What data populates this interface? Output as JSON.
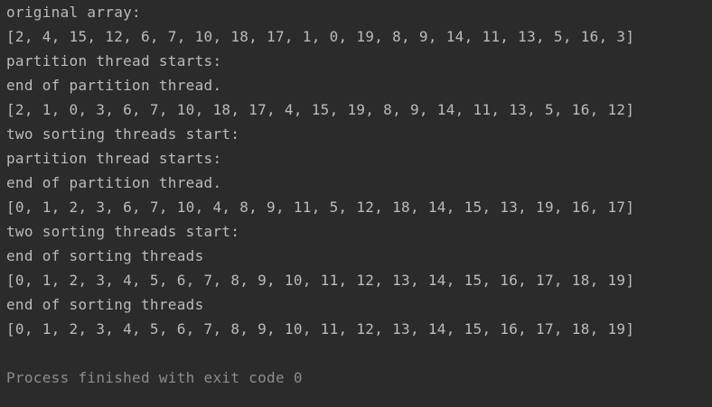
{
  "console": {
    "lines": [
      "original array:",
      "[2, 4, 15, 12, 6, 7, 10, 18, 17, 1, 0, 19, 8, 9, 14, 11, 13, 5, 16, 3]",
      "partition thread starts:",
      "end of partition thread.",
      "[2, 1, 0, 3, 6, 7, 10, 18, 17, 4, 15, 19, 8, 9, 14, 11, 13, 5, 16, 12]",
      "two sorting threads start:",
      "partition thread starts:",
      "end of partition thread.",
      "[0, 1, 2, 3, 6, 7, 10, 4, 8, 9, 11, 5, 12, 18, 14, 15, 13, 19, 16, 17]",
      "two sorting threads start:",
      "end of sorting threads",
      "[0, 1, 2, 3, 4, 5, 6, 7, 8, 9, 10, 11, 12, 13, 14, 15, 16, 17, 18, 19]",
      "end of sorting threads",
      "[0, 1, 2, 3, 4, 5, 6, 7, 8, 9, 10, 11, 12, 13, 14, 15, 16, 17, 18, 19]"
    ],
    "exit_message": "Process finished with exit code 0"
  },
  "colors": {
    "background": "#2b2b2b",
    "output_text": "#bbbbbb",
    "exit_text": "#8c8c8c"
  }
}
